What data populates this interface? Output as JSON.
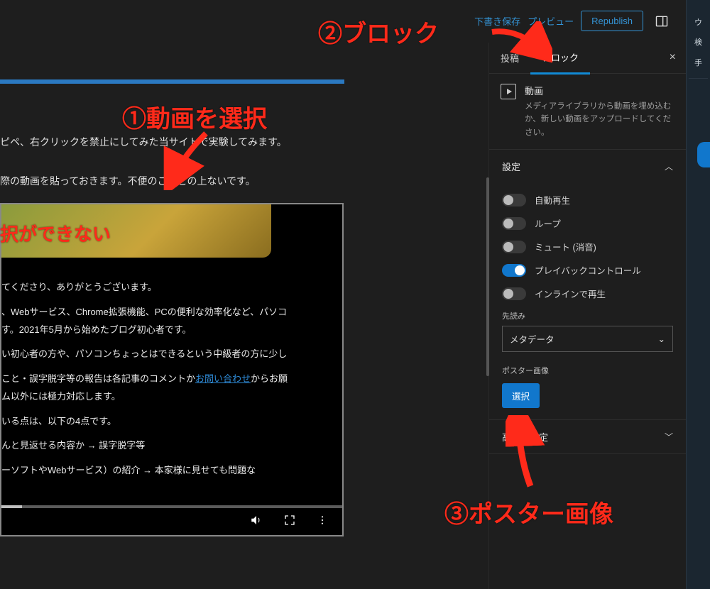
{
  "top": {
    "save_draft": "下書き保存",
    "preview": "プレビュー",
    "republish": "Republish"
  },
  "editor": {
    "line1": "ピペ、右クリックを禁止にしてみた当サイトで実験してみます。",
    "line2": "際の動画を貼っておきます。不便のことこの上ないです。"
  },
  "video_overlay": "択ができない",
  "video_body": {
    "p1": "てくださり、ありがとうございます。",
    "p2": "、Webサービス、Chrome拡張機能、PCの便利な効率化など、パソコ",
    "p2b": "す。2021年5月から始めたブログ初心者です。",
    "p3": "い初心者の方や、パソコンちょっとはできるという中級者の方に少し",
    "p4a": "こと・誤字脱字等の報告は各記事のコメントか",
    "p4link": "お問い合わせ",
    "p4b": "からお願",
    "p4c": "ム以外には極力対応します。",
    "p5": "いる点は、以下の4点です。",
    "p6": "んと見返せる内容か → 誤字脱字等",
    "p7": "ーソフトやWebサービス）の紹介 → 本家様に見せても問題な"
  },
  "tabs": {
    "post": "投稿",
    "block": "ブロック"
  },
  "block": {
    "name": "動画",
    "desc": "メディアライブラリから動画を埋め込むか、新しい動画をアップロードしてください。"
  },
  "settings": {
    "title": "設定",
    "autoplay": "自動再生",
    "loop": "ループ",
    "mute": "ミュート (消音)",
    "playback": "プレイバックコントロール",
    "inline": "インラインで再生",
    "preload_label": "先読み",
    "preload_value": "メタデータ",
    "poster_label": "ポスター画像",
    "select": "選択"
  },
  "advanced": {
    "title": "高度な設定"
  },
  "rail": {
    "a": "ウ",
    "b": "検",
    "c": "手"
  },
  "annotations": {
    "a1": "①動画を選択",
    "a2": "②ブロック",
    "a3": "③ポスター画像"
  }
}
